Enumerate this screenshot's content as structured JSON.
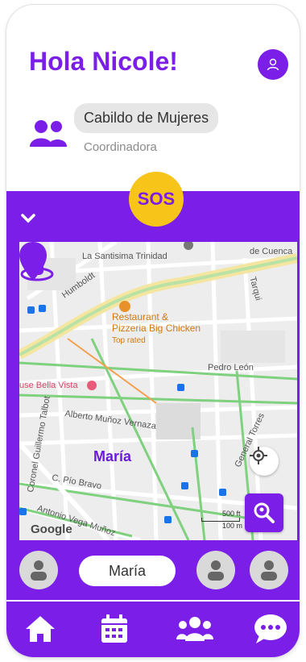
{
  "header": {
    "greeting": "Hola Nicole!"
  },
  "organization": {
    "name": "Cabildo de Mujeres",
    "role": "Coordinadora"
  },
  "sos": {
    "label": "SOS"
  },
  "map": {
    "place_labels": {
      "trinidad": "La Santisima Trinidad",
      "cuenca": "de Cuenca",
      "humboldt": "Humboldt",
      "tarqui": "Tarqui",
      "pedro_leon": "Pedro León",
      "bella_vista": "use Bella Vista",
      "alberto": "Alberto Muñoz Vernaza",
      "talbot": "Coronel Guillermo Talbot",
      "pio_bravo": "C. Pío Bravo",
      "general_torres": "General Torres",
      "antonio_vega": "Antonio Vega Muñoz"
    },
    "restaurant": {
      "name_line1": "Restaurant &",
      "name_line2": "Pizzeria Big Chicken",
      "tag": "Top rated"
    },
    "person_name": "María",
    "scale": {
      "ft": "500 ft",
      "m": "100 m"
    },
    "attribution": "Google"
  },
  "contacts": {
    "selected_name": "María"
  },
  "colors": {
    "primary": "#7a1ee8",
    "sos": "#f7c41a"
  },
  "nav": {
    "items": [
      "home-icon",
      "calendar-icon",
      "group-icon",
      "chat-icon"
    ]
  }
}
